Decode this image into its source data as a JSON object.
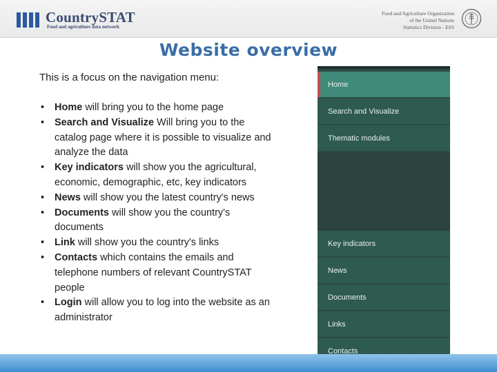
{
  "header": {
    "logo_title": "CountrySTAT",
    "logo_subtitle": "Food and agriculture data network",
    "org_line1": "Food and Agriculture Organization",
    "org_line2": "of the United Nations",
    "org_line3": "Statistics Division - ESS",
    "logo_icon": "bars-icon",
    "emblem_icon": "fao-emblem-icon",
    "colors": {
      "logo": "#2b5aa0",
      "title": "#3a6ea5",
      "nav": "#2e5a50",
      "nav_active": "#3f8a78"
    }
  },
  "slide": {
    "title": "Website overview",
    "intro": "This is a focus on the navigation menu:",
    "bullets": [
      {
        "term": "Home",
        "text": " will bring you to the home page"
      },
      {
        "term": "Search and Visualize",
        "text": " Will bring you to the catalog page where it is possible to visualize and analyze the data"
      },
      {
        "term": "Key indicators",
        "text": " will show you the agricultural, economic, demographic, etc, key indicators"
      },
      {
        "term": "News",
        "text": " will show you the latest country's news"
      },
      {
        "term": "Documents",
        "text": " will show you the country's documents"
      },
      {
        "term": "Link",
        "text": " will show you the country's links"
      },
      {
        "term": "Contacts",
        "text": " which contains the emails and telephone numbers of relevant CountrySTAT people"
      },
      {
        "term": "Login",
        "text": " will allow you to log into the website as an administrator"
      }
    ]
  },
  "nav": {
    "items": [
      {
        "label": "Home"
      },
      {
        "label": "Search and Visualize"
      },
      {
        "label": "Thematic modules"
      },
      {
        "label": "Key indicators"
      },
      {
        "label": "News"
      },
      {
        "label": "Documents"
      },
      {
        "label": "Links"
      },
      {
        "label": "Contacts"
      }
    ]
  }
}
